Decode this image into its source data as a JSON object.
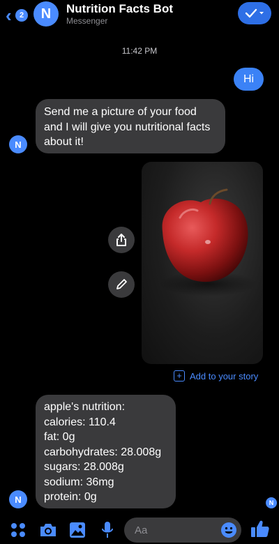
{
  "header": {
    "back_badge": "2",
    "avatar_letter": "N",
    "title": "Nutrition Facts Bot",
    "subtitle": "Messenger"
  },
  "conversation": {
    "timestamp": "11:42 PM",
    "outgoing_text": "Hi",
    "bot_avatar_letter": "N",
    "bot_greeting": "Send me a picture of your food and I will give you nutritional facts about it!",
    "nutrition_lines": [
      "apple's nutrition:",
      "calories: 110.4",
      "fat: 0g",
      "carbohydrates: 28.008g",
      "sugars: 28.008g",
      "sodium: 36mg",
      "protein: 0g"
    ],
    "story_link": "Add to your story",
    "seen_avatar_letter": "N"
  },
  "composer": {
    "placeholder": "Aa"
  },
  "colors": {
    "accent": "#4a8bff",
    "bubble_incoming": "#3a3a3c",
    "bubble_outgoing": "#3b82f6",
    "background": "#000000"
  },
  "icons": {
    "back": "chevron-left-icon",
    "action": "checkmark-icon",
    "share": "share-icon",
    "edit": "pencil-icon",
    "menu": "four-dots-icon",
    "camera": "camera-icon",
    "gallery": "image-icon",
    "mic": "microphone-icon",
    "emoji": "emoji-icon",
    "like": "thumbs-up-icon"
  }
}
